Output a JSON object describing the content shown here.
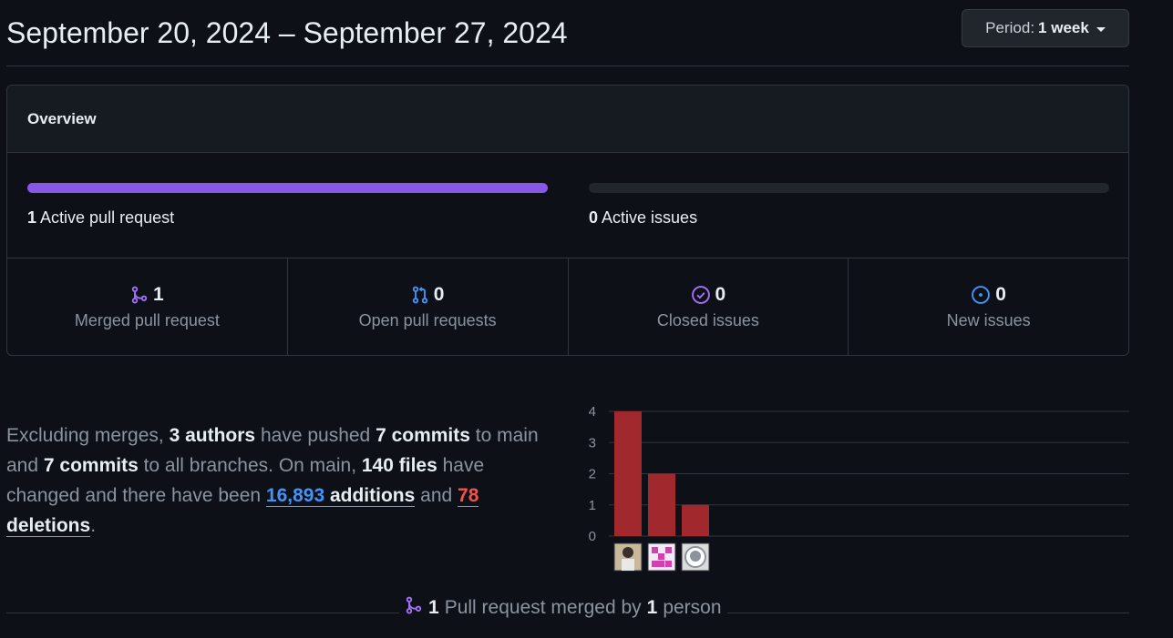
{
  "header": {
    "title": "September 20, 2024 – September 27, 2024",
    "period_prefix": "Period:",
    "period_value": "1 week"
  },
  "overview": {
    "title": "Overview",
    "pull_requests": {
      "count": "1",
      "label": "Active pull request",
      "fill_fraction": 1.0,
      "color": "#8957e5"
    },
    "issues": {
      "count": "0",
      "label": "Active issues",
      "fill_fraction": 0.0
    },
    "stats": [
      {
        "icon": "git-merge-icon",
        "count": "1",
        "label": "Merged pull request",
        "color": "#a371f7"
      },
      {
        "icon": "git-pull-request-icon",
        "count": "0",
        "label": "Open pull requests",
        "color": "#3fb950"
      },
      {
        "icon": "issue-closed-icon",
        "count": "0",
        "label": "Closed issues",
        "color": "#a371f7"
      },
      {
        "icon": "issue-opened-icon",
        "count": "0",
        "label": "New issues",
        "color": "#3fb950"
      }
    ]
  },
  "summary": {
    "t1": "Excluding merges, ",
    "authors": "3 authors",
    "t2": " have pushed ",
    "commits_main": "7 commits",
    "t3": " to main and ",
    "commits_all": "7 commits",
    "t4": " to all branches. On main, ",
    "files": "140 files",
    "t5": " have changed and there have been ",
    "additions_num": "16,893",
    "additions_word": " additions",
    "t6": " and ",
    "deletions_num": "78",
    "deletions_word": " deletions",
    "t7": "."
  },
  "chart_data": {
    "type": "bar",
    "categories": [
      "author-1",
      "author-2",
      "author-3"
    ],
    "values": [
      4,
      2,
      1
    ],
    "ylim": [
      0,
      4
    ],
    "yticks": [
      "0",
      "1",
      "2",
      "3",
      "4"
    ],
    "bar_color": "#a1282c",
    "grid": true,
    "xlabel": "",
    "ylabel": ""
  },
  "footer": {
    "count": "1",
    "t1": "Pull request merged by",
    "people": "1",
    "t2": "person"
  }
}
